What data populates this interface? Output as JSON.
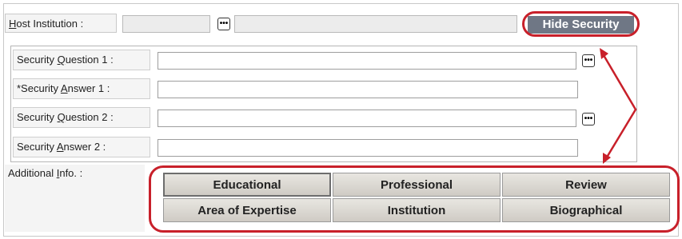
{
  "host": {
    "label_pre": "",
    "label_u": "H",
    "label_post": "ost Institution :",
    "hide_security_label": "Hide Security"
  },
  "security": {
    "rows": [
      {
        "pre": "Security ",
        "u": "Q",
        "post": "uestion 1 :",
        "has_lookup": true
      },
      {
        "pre": "*Security ",
        "u": "A",
        "post": "nswer 1 :",
        "has_lookup": false
      },
      {
        "pre": "Security ",
        "u": "Q",
        "post": "uestion 2 :",
        "has_lookup": true
      },
      {
        "pre": "Security ",
        "u": "A",
        "post": "nswer 2 :",
        "has_lookup": false
      }
    ]
  },
  "additional": {
    "label_pre": "Additional ",
    "label_u": "I",
    "label_post": "nfo. :",
    "buttons": [
      "Educational",
      "Professional",
      "Review",
      "Area of Expertise",
      "Institution",
      "Biographical"
    ]
  },
  "icons": {
    "lookup": "ellipsis-icon"
  },
  "colors": {
    "annotation": "#c8202a",
    "hide_security_bg": "#6f7785"
  }
}
